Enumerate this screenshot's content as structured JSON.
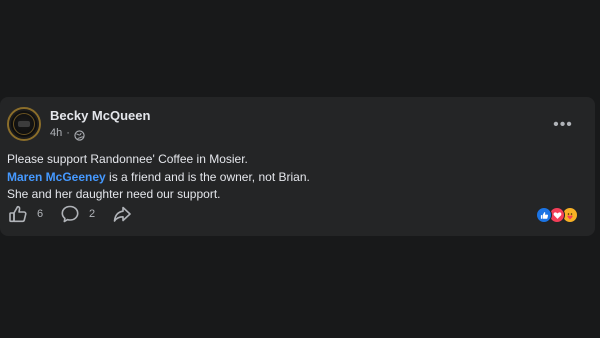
{
  "post": {
    "author": "Becky McQueen",
    "time": "4h",
    "separator": "·",
    "audience_icon": "globe-icon",
    "more_label": "•••",
    "body": {
      "line1": "Please support Randonnee' Coffee in Mosier.",
      "mention": "Maren McGeeney",
      "line2_rest": " is a friend and is the owner, not Brian.",
      "line3": "She and her daughter need our support."
    },
    "actions": {
      "like_count": "6",
      "comment_count": "2"
    },
    "reactions": [
      "like-reaction-icon",
      "love-reaction-icon",
      "care-reaction-icon"
    ]
  },
  "colors": {
    "page_bg": "#18191a",
    "card_bg": "#242526",
    "text_primary": "#e4e6eb",
    "text_secondary": "#b0b3b8",
    "mention": "#4599ff",
    "like_blue": "#1b74e4",
    "love_red": "#f33e58",
    "care_yellow": "#f7b125"
  }
}
